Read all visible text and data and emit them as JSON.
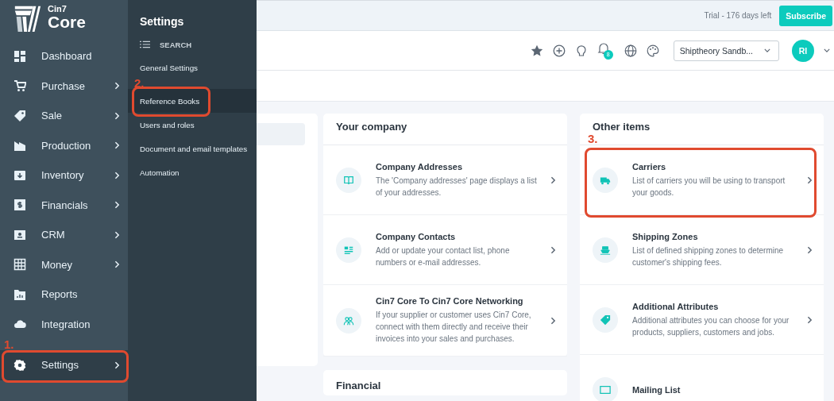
{
  "logo": {
    "small": "Cin7",
    "large": "Core"
  },
  "nav": [
    {
      "label": "Dashboard",
      "kind": "dashboard",
      "has_submenu": false,
      "selected": false
    },
    {
      "label": "Purchase",
      "kind": "cart",
      "has_submenu": true,
      "selected": false
    },
    {
      "label": "Sale",
      "kind": "tag",
      "has_submenu": true,
      "selected": false
    },
    {
      "label": "Production",
      "kind": "factory",
      "has_submenu": true,
      "selected": false
    },
    {
      "label": "Inventory",
      "kind": "inbox",
      "has_submenu": true,
      "selected": false
    },
    {
      "label": "Financials",
      "kind": "dollar",
      "has_submenu": true,
      "selected": false
    },
    {
      "label": "CRM",
      "kind": "contact",
      "has_submenu": true,
      "selected": false
    },
    {
      "label": "Money",
      "kind": "grid",
      "has_submenu": true,
      "selected": false
    },
    {
      "label": "Reports",
      "kind": "chart",
      "has_submenu": false,
      "selected": false
    },
    {
      "label": "Integration",
      "kind": "cloud",
      "has_submenu": false,
      "selected": false
    },
    {
      "label": "Settings",
      "kind": "gear",
      "has_submenu": true,
      "selected": true,
      "callout": "1."
    }
  ],
  "submenu": {
    "title": "Settings",
    "search": "SEARCH",
    "items": [
      {
        "label": "General Settings",
        "selected": false
      },
      {
        "label": "Reference Books",
        "selected": true,
        "callout": "2."
      },
      {
        "label": "Users and roles",
        "selected": false
      },
      {
        "label": "Document and email templates",
        "selected": false
      },
      {
        "label": "Automation",
        "selected": false
      }
    ]
  },
  "trial_bar": {
    "text": "Trial - 176 days left",
    "button": "Subscribe"
  },
  "header": {
    "notification_count": "8",
    "company": "Shiptheory Sandb...",
    "avatar": "RI"
  },
  "cards": [
    {
      "title": "Your company",
      "items": [
        {
          "title": "Company Addresses",
          "description": "The 'Company addresses' page displays a list of your addresses.",
          "kind": "book"
        },
        {
          "title": "Company Contacts",
          "description": "Add or update your contact list, phone numbers or e-mail addresses.",
          "kind": "contacts"
        },
        {
          "title": "Cin7 Core To Cin7 Core Networking",
          "description": "If your supplier or customer uses Cin7 Core, connect with them directly and receive their invoices into your sales and purchases.",
          "kind": "people"
        }
      ]
    },
    {
      "title": "Other items",
      "callout": "3.",
      "items": [
        {
          "title": "Carriers",
          "description": "List of carriers you will be using to transport your goods.",
          "kind": "truck",
          "highlighted": true
        },
        {
          "title": "Shipping Zones",
          "description": "List of defined shipping zones to determine customer's shipping fees.",
          "kind": "ship"
        },
        {
          "title": "Additional Attributes",
          "description": "Additional attributes you can choose for your products, suppliers, customers and jobs.",
          "kind": "tag"
        },
        {
          "title": "Mailing List",
          "kind": "mail"
        }
      ]
    }
  ],
  "lower_cards": [
    {
      "title": "Financial"
    }
  ]
}
